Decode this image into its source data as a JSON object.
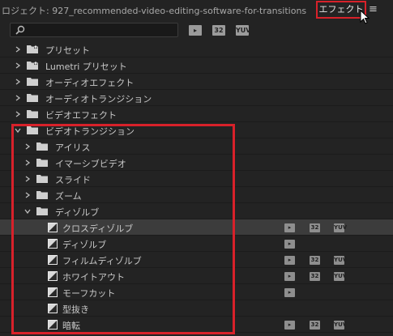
{
  "header": {
    "project_title": "ロジェクト: 927_recommended-video-editing-software-for-transitions",
    "panel_tab": "エフェクト",
    "menu_icon": "hamburger-icon"
  },
  "toolbar": {
    "search_placeholder": "",
    "filters": [
      {
        "label": "▸",
        "name": "accelerated-filter"
      },
      {
        "label": "32",
        "name": "32bit-filter"
      },
      {
        "label": "YUV",
        "name": "yuv-filter"
      }
    ]
  },
  "tree": [
    {
      "label": "プリセット",
      "type": "folder-star",
      "level": 0,
      "expanded": false
    },
    {
      "label": "Lumetri プリセット",
      "type": "folder-star",
      "level": 0,
      "expanded": false
    },
    {
      "label": "オーディオエフェクト",
      "type": "folder",
      "level": 0,
      "expanded": false
    },
    {
      "label": "オーディオトランジション",
      "type": "folder",
      "level": 0,
      "expanded": false
    },
    {
      "label": "ビデオエフェクト",
      "type": "folder",
      "level": 0,
      "expanded": false
    },
    {
      "label": "ビデオトランジション",
      "type": "folder",
      "level": 0,
      "expanded": true
    },
    {
      "label": "アイリス",
      "type": "folder",
      "level": 1,
      "expanded": false
    },
    {
      "label": "イマーシブビデオ",
      "type": "folder",
      "level": 1,
      "expanded": false
    },
    {
      "label": "スライド",
      "type": "folder",
      "level": 1,
      "expanded": false
    },
    {
      "label": "ズーム",
      "type": "folder",
      "level": 1,
      "expanded": false
    },
    {
      "label": "ディゾルブ",
      "type": "folder",
      "level": 1,
      "expanded": true
    },
    {
      "label": "クロスディゾルブ",
      "type": "effect",
      "level": 2,
      "badges": [
        true,
        true,
        true
      ],
      "selected": true
    },
    {
      "label": "ディゾルブ",
      "type": "effect",
      "level": 2,
      "badges": [
        true,
        false,
        false
      ]
    },
    {
      "label": "フィルムディゾルブ",
      "type": "effect",
      "level": 2,
      "badges": [
        true,
        true,
        true
      ]
    },
    {
      "label": "ホワイトアウト",
      "type": "effect",
      "level": 2,
      "badges": [
        true,
        true,
        true
      ]
    },
    {
      "label": "モーフカット",
      "type": "effect",
      "level": 2,
      "badges": [
        true,
        false,
        false
      ]
    },
    {
      "label": "型抜き",
      "type": "effect",
      "level": 2,
      "badges": [
        false,
        false,
        false
      ]
    },
    {
      "label": "暗転",
      "type": "effect",
      "level": 2,
      "badges": [
        true,
        true,
        true
      ]
    }
  ],
  "badge_labels": [
    "▸",
    "32",
    "YUV"
  ],
  "colors": {
    "background": "#232323",
    "highlight": "#d8212a",
    "selected_row": "#3c3c3c"
  }
}
